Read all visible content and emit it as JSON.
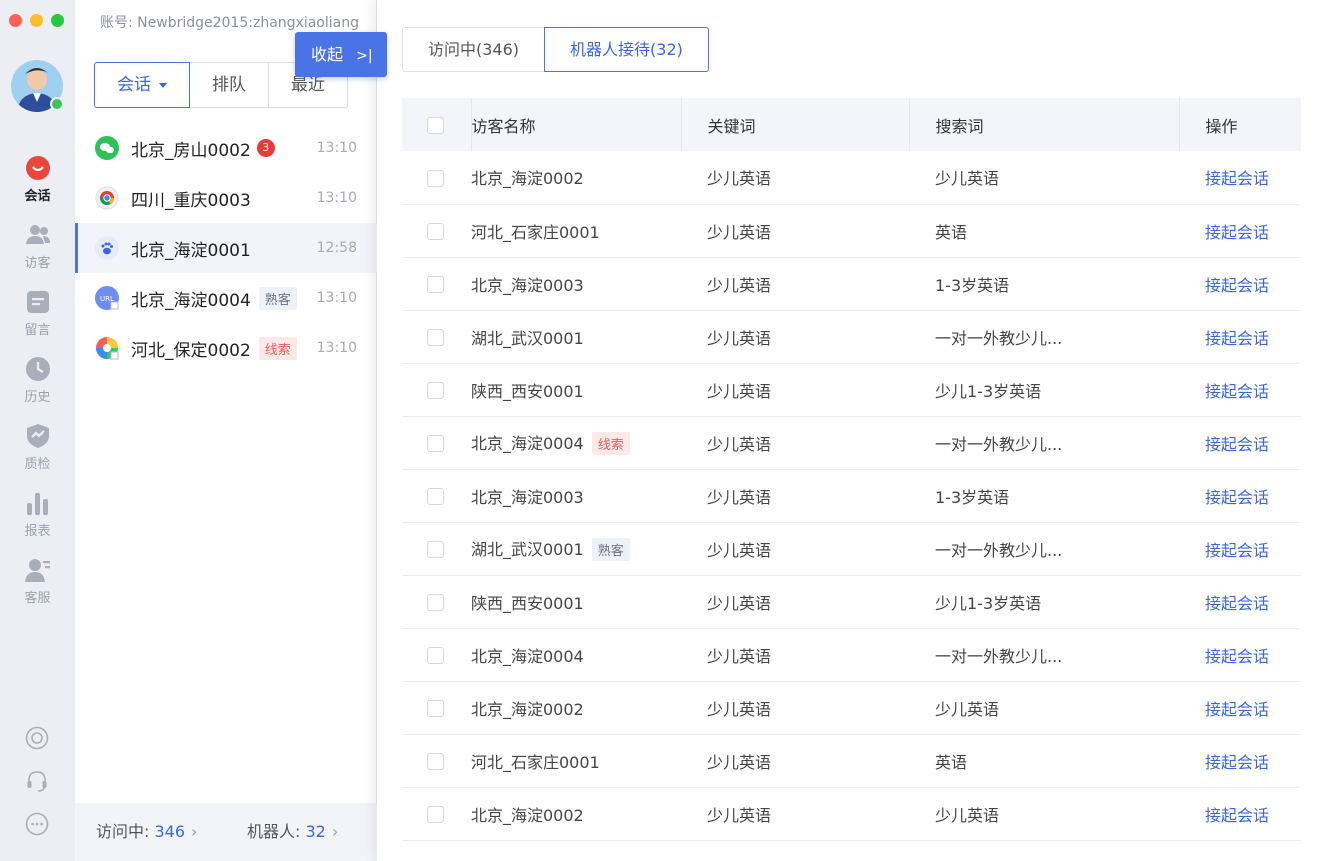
{
  "sidebar": {
    "items": [
      {
        "label": "会话",
        "icon": "chat-bubble-icon",
        "active": true
      },
      {
        "label": "访客",
        "icon": "visitors-icon"
      },
      {
        "label": "留言",
        "icon": "message-note-icon"
      },
      {
        "label": "历史",
        "icon": "clock-icon"
      },
      {
        "label": "质检",
        "icon": "shield-check-icon"
      },
      {
        "label": "报表",
        "icon": "bar-chart-icon"
      },
      {
        "label": "客服",
        "icon": "agent-icon"
      }
    ],
    "bottom_icons": [
      "target-icon",
      "headset-icon",
      "more-icon"
    ],
    "colors": {
      "active": "#e8473b",
      "inactive": "#9aa1ad"
    }
  },
  "account": "账号: Newbridge2015:zhangxiaoliang",
  "segments": {
    "session": "会话",
    "queue": "排队",
    "recent": "最近"
  },
  "conversations": [
    {
      "name": "北京_房山0002",
      "badge": "3",
      "time": "13:10",
      "icon": "wechat-icon"
    },
    {
      "name": "四川_重庆0003",
      "time": "13:10",
      "icon": "chrome-icon"
    },
    {
      "name": "北京_海淀0001",
      "time": "12:58",
      "icon": "baidu-paw-icon",
      "selected": true
    },
    {
      "name": "北京_海淀0004",
      "tag": "熟客",
      "time": "13:10",
      "icon": "url-icon"
    },
    {
      "name": "河北_保定0002",
      "tag": "线索",
      "time": "13:10",
      "icon": "color-wheel-icon"
    }
  ],
  "footer": {
    "visiting_label": "访问中:",
    "visiting_count": "346",
    "robot_label": "机器人:",
    "robot_count": "32",
    "chevron": "›"
  },
  "collapse": {
    "label": "收起",
    "arrow": ">|"
  },
  "tabs": {
    "visiting": "访问中(346)",
    "robot": "机器人接待(32)"
  },
  "table": {
    "headers": {
      "name": "访客名称",
      "keyword": "关键词",
      "search": "搜索词",
      "op": "操作"
    },
    "rows": [
      {
        "name": "北京_海淀0002",
        "keyword": "少儿英语",
        "search": "少儿英语",
        "op": "接起会话"
      },
      {
        "name": "河北_石家庄0001",
        "keyword": "少儿英语",
        "search": "英语",
        "op": "接起会话"
      },
      {
        "name": "北京_海淀0003",
        "keyword": "少儿英语",
        "search": "1-3岁英语",
        "op": "接起会话"
      },
      {
        "name": "湖北_武汉0001",
        "keyword": "少儿英语",
        "search": "一对一外教少儿...",
        "op": "接起会话"
      },
      {
        "name": "陕西_西安0001",
        "keyword": "少儿英语",
        "search": "少儿1-3岁英语",
        "op": "接起会话"
      },
      {
        "name": "北京_海淀0004",
        "tag": "线索",
        "keyword": "少儿英语",
        "search": "一对一外教少儿...",
        "op": "接起会话"
      },
      {
        "name": "北京_海淀0003",
        "keyword": "少儿英语",
        "search": "1-3岁英语",
        "op": "接起会话"
      },
      {
        "name": "湖北_武汉0001",
        "tag": "熟客",
        "keyword": "少儿英语",
        "search": "一对一外教少儿...",
        "op": "接起会话"
      },
      {
        "name": "陕西_西安0001",
        "keyword": "少儿英语",
        "search": "少儿1-3岁英语",
        "op": "接起会话"
      },
      {
        "name": "北京_海淀0004",
        "keyword": "少儿英语",
        "search": "一对一外教少儿...",
        "op": "接起会话"
      },
      {
        "name": "北京_海淀0002",
        "keyword": "少儿英语",
        "search": "少儿英语",
        "op": "接起会话"
      },
      {
        "name": "河北_石家庄0001",
        "keyword": "少儿英语",
        "search": "英语",
        "op": "接起会话"
      },
      {
        "name": "北京_海淀0002",
        "keyword": "少儿英语",
        "search": "少儿英语",
        "op": "接起会话"
      }
    ]
  },
  "accent": "#4a74e6"
}
